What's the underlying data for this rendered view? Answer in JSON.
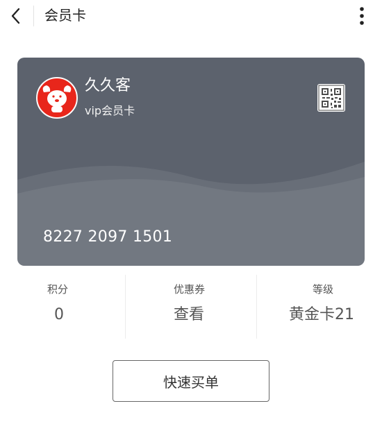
{
  "header": {
    "title": "会员卡",
    "back_icon": "chevron-left-icon",
    "more_icon": "more-vertical-icon"
  },
  "card": {
    "store_name": "久久客",
    "card_type": "vip会员卡",
    "card_number": "8227 2097 1501",
    "background_color": "#5c626d",
    "logo_icon": "mascot-dog-icon",
    "qr_icon": "qr-code-icon"
  },
  "stats": [
    {
      "label": "积分",
      "value": "0"
    },
    {
      "label": "优惠券",
      "value": "查看"
    },
    {
      "label": "等级",
      "value": "黄金卡21"
    }
  ],
  "action": {
    "label": "快速买单"
  }
}
